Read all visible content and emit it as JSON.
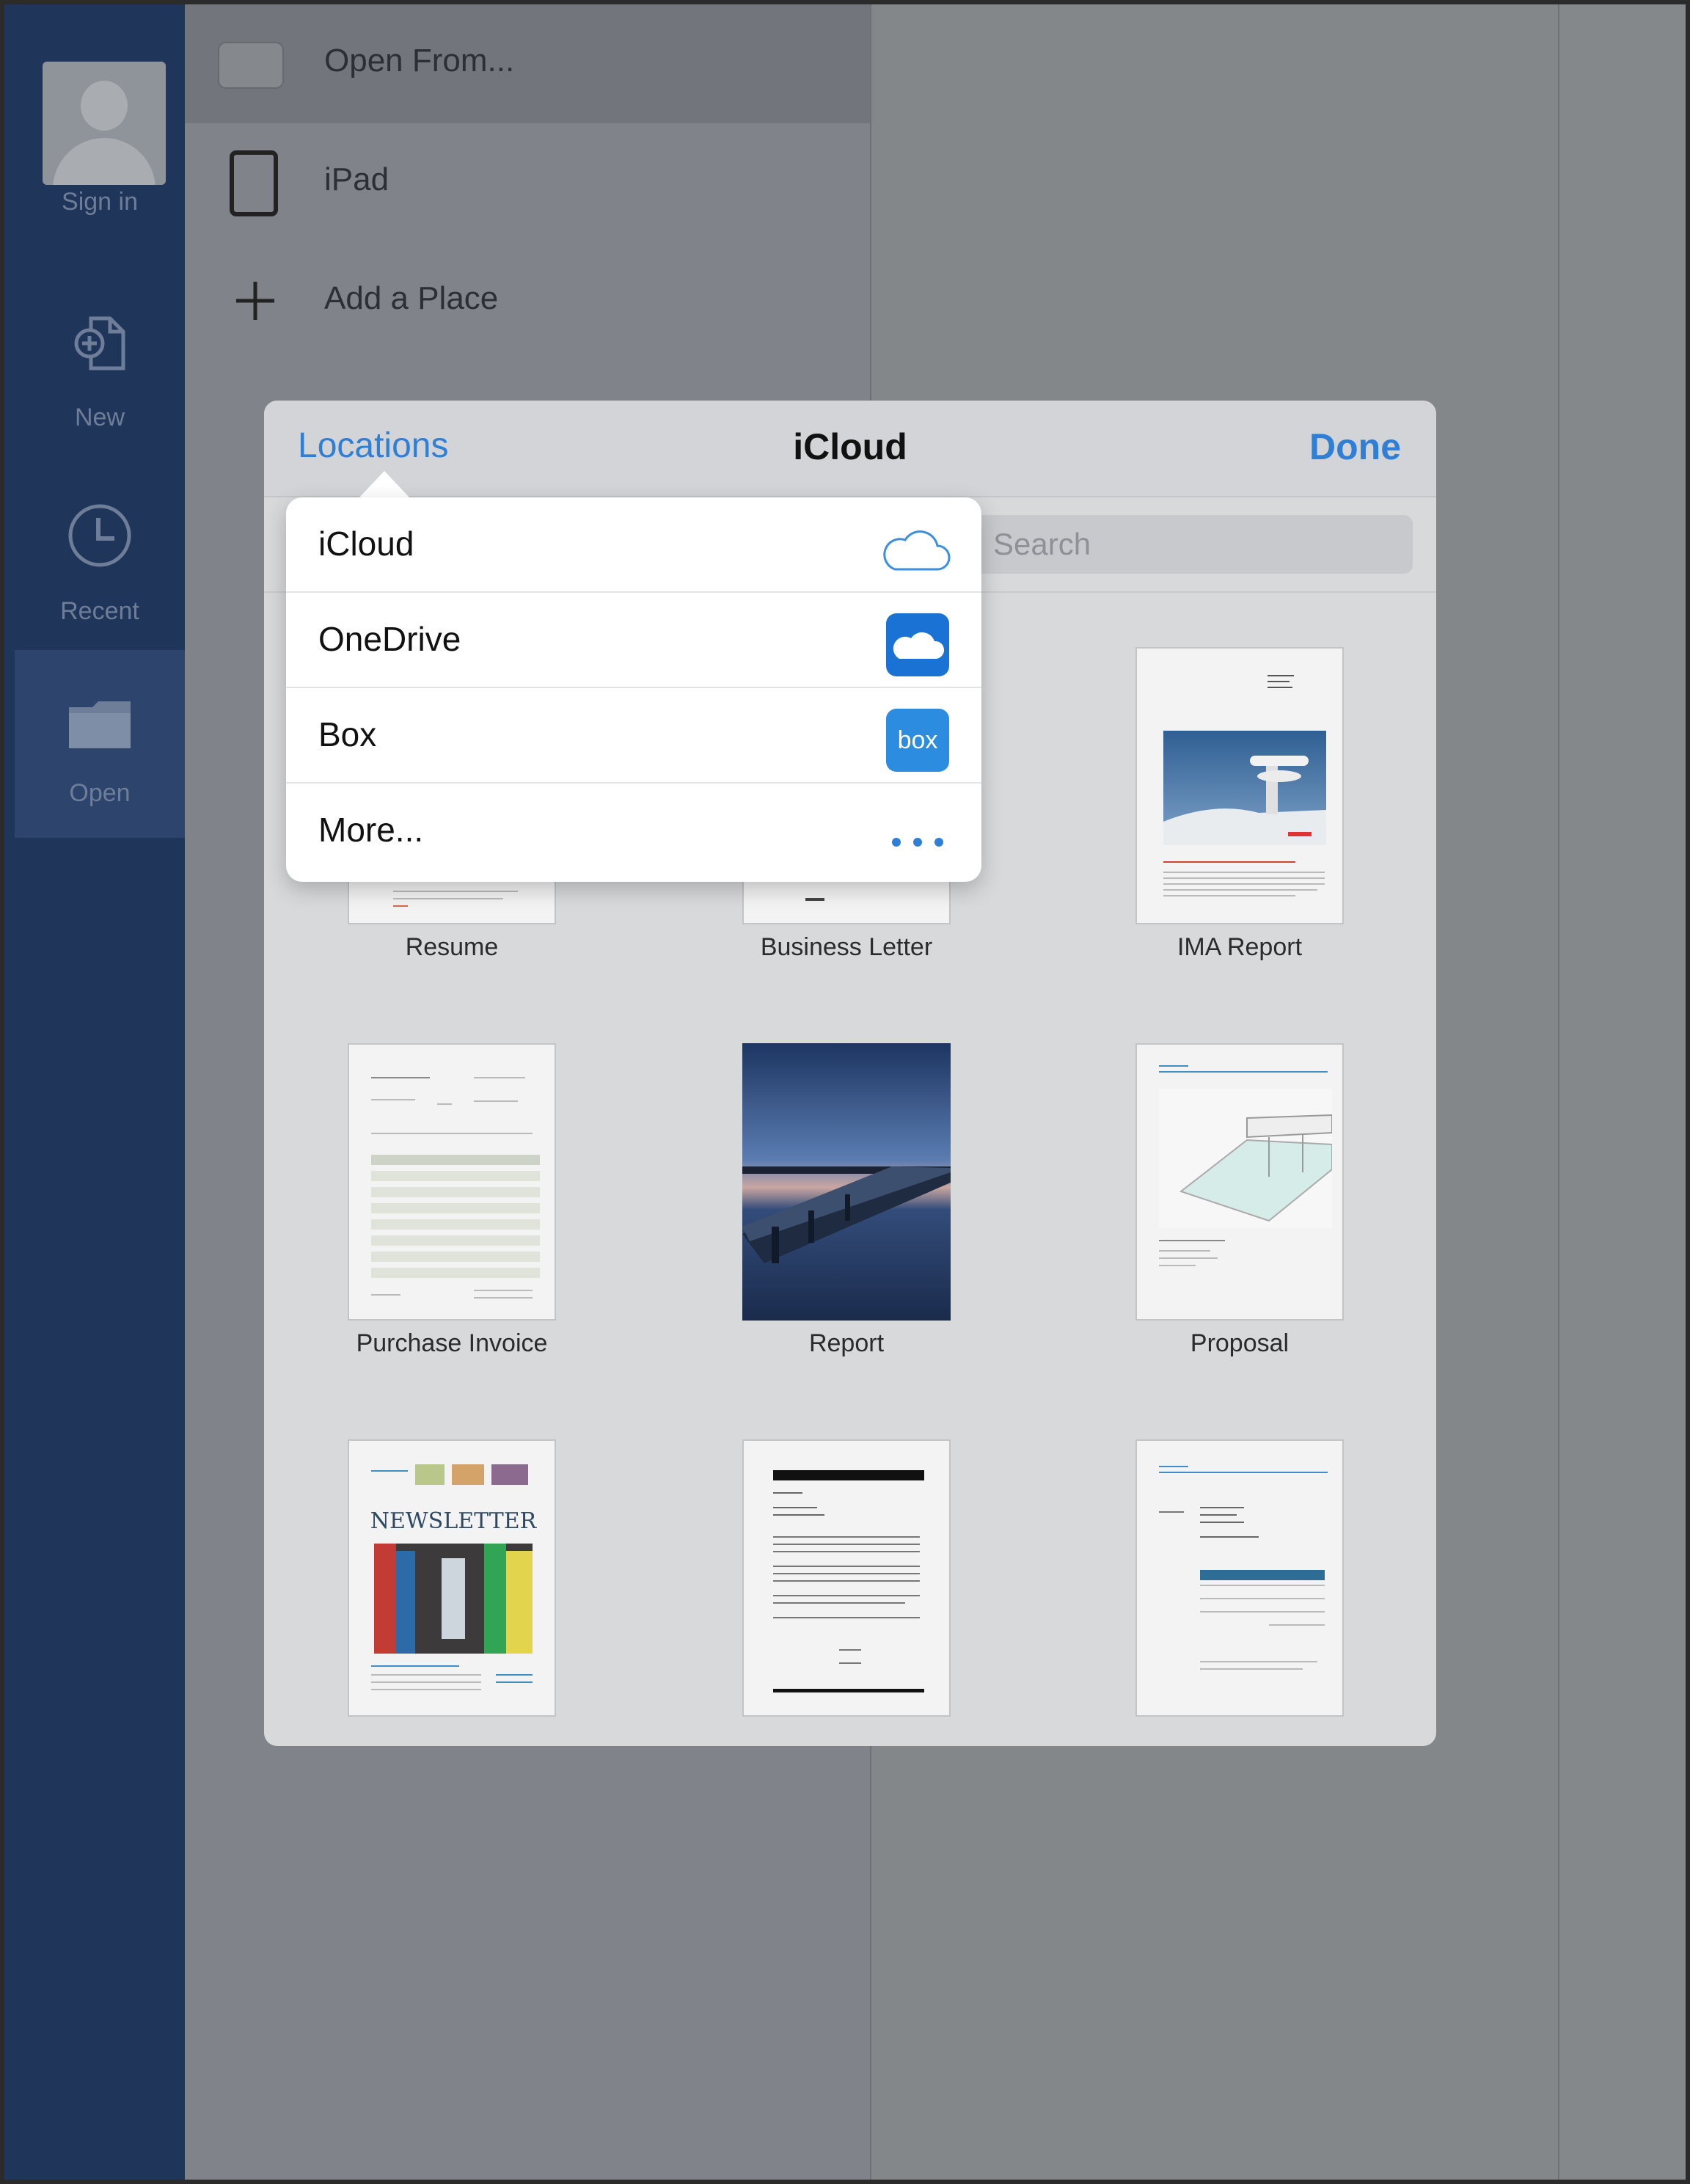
{
  "nav": {
    "items": [
      {
        "label": "Sign in",
        "icon": "avatar"
      },
      {
        "label": "New",
        "icon": "new-document-icon"
      },
      {
        "label": "Recent",
        "icon": "clock-icon"
      },
      {
        "label": "Open",
        "icon": "folder-icon"
      }
    ]
  },
  "places": {
    "items": [
      {
        "label": "Open From...",
        "icon": "folder-icon"
      },
      {
        "label": "iPad",
        "icon": "ipad-icon"
      },
      {
        "label": "Add a Place",
        "icon": "plus-icon"
      }
    ]
  },
  "dialog": {
    "left_label": "Locations",
    "title": "iCloud",
    "right_label": "Done",
    "search_placeholder": "Search",
    "documents": [
      {
        "label": "Resume"
      },
      {
        "label": "Business Letter"
      },
      {
        "label": "IMA Report"
      },
      {
        "label": "Purchase Invoice"
      },
      {
        "label": "Report"
      },
      {
        "label": "Proposal"
      },
      {
        "label": ""
      },
      {
        "label": ""
      },
      {
        "label": ""
      }
    ],
    "newsletter_title": "NEWSLETTER"
  },
  "popover": {
    "items": [
      {
        "label": "iCloud",
        "icon": "icloud-icon"
      },
      {
        "label": "OneDrive",
        "icon": "onedrive-icon"
      },
      {
        "label": "Box",
        "icon": "box-icon",
        "icon_text": "box"
      },
      {
        "label": "More...",
        "icon": "more-icon"
      }
    ]
  },
  "colors": {
    "nav_bg": "#1f3559",
    "accent": "#2f7fd6",
    "onedrive": "#1a73d4",
    "box": "#2b8ce0"
  }
}
